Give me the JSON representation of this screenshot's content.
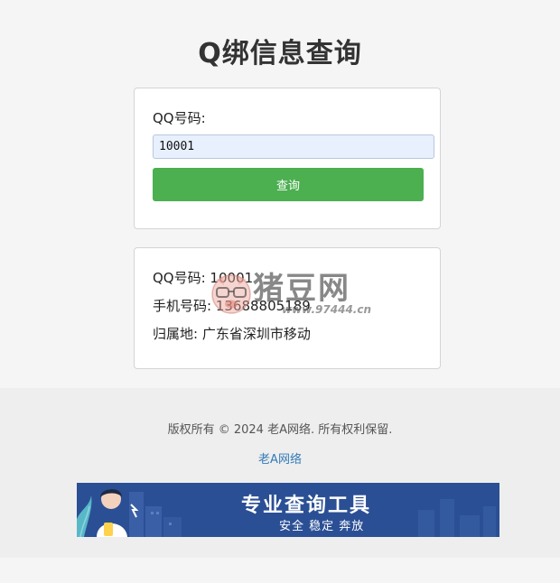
{
  "page": {
    "title": "Q绑信息查询"
  },
  "form": {
    "qq_label": "QQ号码:",
    "qq_value": "10001",
    "query_button": "查询"
  },
  "result": {
    "qq_line": "QQ号码: 10001",
    "phone_line": "手机号码: 13688805189",
    "location_line": "归属地: 广东省深圳市移动"
  },
  "watermark": {
    "text": "猪豆网",
    "url": "www.97444.cn"
  },
  "footer": {
    "copyright": "版权所有 © 2024 老A网络. 所有权利保留.",
    "link_text": "老A网络"
  },
  "banner": {
    "title": "专业查询工具",
    "subtitle": "安全 稳定 奔放"
  },
  "colors": {
    "button": "#4caf50",
    "input_bg": "#e8f0fe",
    "link": "#337ab7",
    "banner_bg": "#2b4f95"
  }
}
